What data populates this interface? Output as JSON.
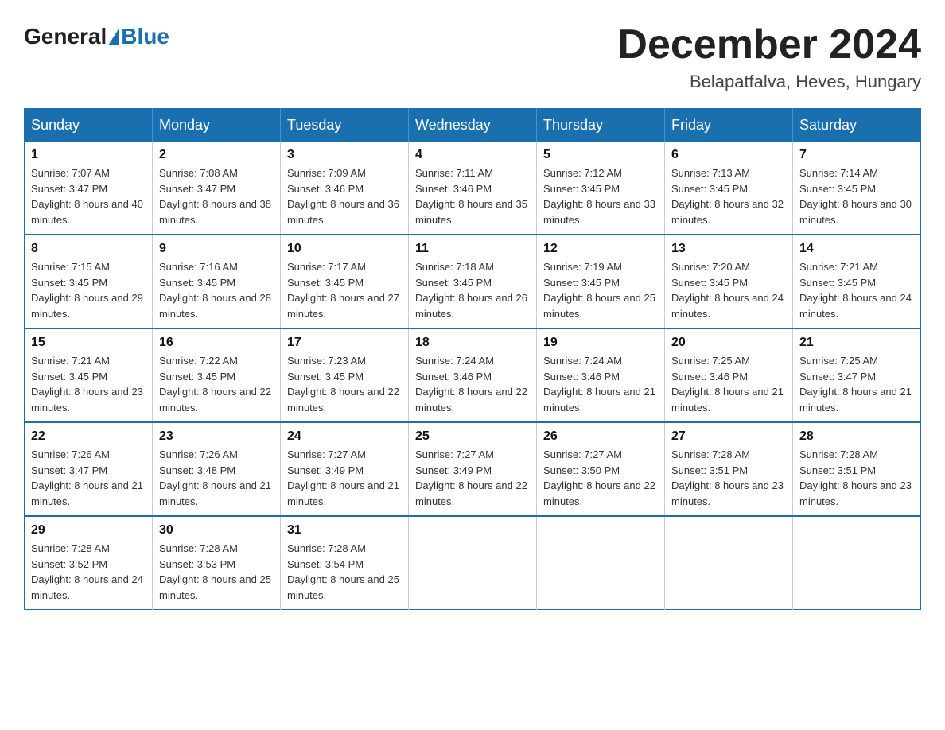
{
  "header": {
    "logo": {
      "general": "General",
      "blue": "Blue"
    },
    "title": "December 2024",
    "subtitle": "Belapatfalva, Heves, Hungary"
  },
  "calendar": {
    "weekdays": [
      "Sunday",
      "Monday",
      "Tuesday",
      "Wednesday",
      "Thursday",
      "Friday",
      "Saturday"
    ],
    "weeks": [
      [
        {
          "day": "1",
          "sunrise": "7:07 AM",
          "sunset": "3:47 PM",
          "daylight": "8 hours and 40 minutes."
        },
        {
          "day": "2",
          "sunrise": "7:08 AM",
          "sunset": "3:47 PM",
          "daylight": "8 hours and 38 minutes."
        },
        {
          "day": "3",
          "sunrise": "7:09 AM",
          "sunset": "3:46 PM",
          "daylight": "8 hours and 36 minutes."
        },
        {
          "day": "4",
          "sunrise": "7:11 AM",
          "sunset": "3:46 PM",
          "daylight": "8 hours and 35 minutes."
        },
        {
          "day": "5",
          "sunrise": "7:12 AM",
          "sunset": "3:45 PM",
          "daylight": "8 hours and 33 minutes."
        },
        {
          "day": "6",
          "sunrise": "7:13 AM",
          "sunset": "3:45 PM",
          "daylight": "8 hours and 32 minutes."
        },
        {
          "day": "7",
          "sunrise": "7:14 AM",
          "sunset": "3:45 PM",
          "daylight": "8 hours and 30 minutes."
        }
      ],
      [
        {
          "day": "8",
          "sunrise": "7:15 AM",
          "sunset": "3:45 PM",
          "daylight": "8 hours and 29 minutes."
        },
        {
          "day": "9",
          "sunrise": "7:16 AM",
          "sunset": "3:45 PM",
          "daylight": "8 hours and 28 minutes."
        },
        {
          "day": "10",
          "sunrise": "7:17 AM",
          "sunset": "3:45 PM",
          "daylight": "8 hours and 27 minutes."
        },
        {
          "day": "11",
          "sunrise": "7:18 AM",
          "sunset": "3:45 PM",
          "daylight": "8 hours and 26 minutes."
        },
        {
          "day": "12",
          "sunrise": "7:19 AM",
          "sunset": "3:45 PM",
          "daylight": "8 hours and 25 minutes."
        },
        {
          "day": "13",
          "sunrise": "7:20 AM",
          "sunset": "3:45 PM",
          "daylight": "8 hours and 24 minutes."
        },
        {
          "day": "14",
          "sunrise": "7:21 AM",
          "sunset": "3:45 PM",
          "daylight": "8 hours and 24 minutes."
        }
      ],
      [
        {
          "day": "15",
          "sunrise": "7:21 AM",
          "sunset": "3:45 PM",
          "daylight": "8 hours and 23 minutes."
        },
        {
          "day": "16",
          "sunrise": "7:22 AM",
          "sunset": "3:45 PM",
          "daylight": "8 hours and 22 minutes."
        },
        {
          "day": "17",
          "sunrise": "7:23 AM",
          "sunset": "3:45 PM",
          "daylight": "8 hours and 22 minutes."
        },
        {
          "day": "18",
          "sunrise": "7:24 AM",
          "sunset": "3:46 PM",
          "daylight": "8 hours and 22 minutes."
        },
        {
          "day": "19",
          "sunrise": "7:24 AM",
          "sunset": "3:46 PM",
          "daylight": "8 hours and 21 minutes."
        },
        {
          "day": "20",
          "sunrise": "7:25 AM",
          "sunset": "3:46 PM",
          "daylight": "8 hours and 21 minutes."
        },
        {
          "day": "21",
          "sunrise": "7:25 AM",
          "sunset": "3:47 PM",
          "daylight": "8 hours and 21 minutes."
        }
      ],
      [
        {
          "day": "22",
          "sunrise": "7:26 AM",
          "sunset": "3:47 PM",
          "daylight": "8 hours and 21 minutes."
        },
        {
          "day": "23",
          "sunrise": "7:26 AM",
          "sunset": "3:48 PM",
          "daylight": "8 hours and 21 minutes."
        },
        {
          "day": "24",
          "sunrise": "7:27 AM",
          "sunset": "3:49 PM",
          "daylight": "8 hours and 21 minutes."
        },
        {
          "day": "25",
          "sunrise": "7:27 AM",
          "sunset": "3:49 PM",
          "daylight": "8 hours and 22 minutes."
        },
        {
          "day": "26",
          "sunrise": "7:27 AM",
          "sunset": "3:50 PM",
          "daylight": "8 hours and 22 minutes."
        },
        {
          "day": "27",
          "sunrise": "7:28 AM",
          "sunset": "3:51 PM",
          "daylight": "8 hours and 23 minutes."
        },
        {
          "day": "28",
          "sunrise": "7:28 AM",
          "sunset": "3:51 PM",
          "daylight": "8 hours and 23 minutes."
        }
      ],
      [
        {
          "day": "29",
          "sunrise": "7:28 AM",
          "sunset": "3:52 PM",
          "daylight": "8 hours and 24 minutes."
        },
        {
          "day": "30",
          "sunrise": "7:28 AM",
          "sunset": "3:53 PM",
          "daylight": "8 hours and 25 minutes."
        },
        {
          "day": "31",
          "sunrise": "7:28 AM",
          "sunset": "3:54 PM",
          "daylight": "8 hours and 25 minutes."
        },
        null,
        null,
        null,
        null
      ]
    ]
  }
}
